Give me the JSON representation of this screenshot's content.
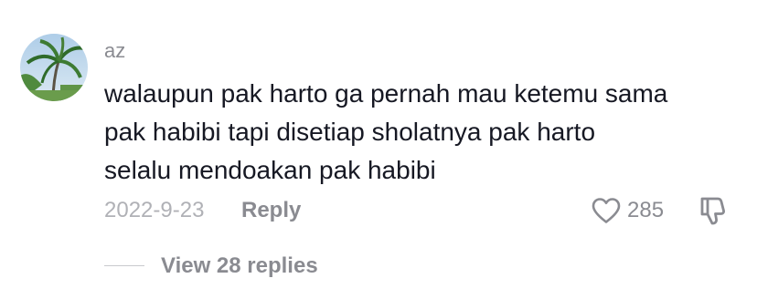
{
  "comment": {
    "username": "az",
    "text_lines": [
      "walaupun pak harto ga pernah mau ketemu sama",
      "pak habibi tapi disetiap sholatnya pak harto",
      "selalu mendoakan pak habibi"
    ],
    "date": "2022-9-23",
    "reply_label": "Reply",
    "like_count": "285",
    "view_replies_label": "View 28 replies"
  },
  "icons": {
    "like": "heart-outline-icon",
    "dislike": "thumbs-down-icon"
  },
  "colors": {
    "text_primary": "#161823",
    "text_secondary": "#8a8b91",
    "text_muted": "#b0b1b6"
  }
}
